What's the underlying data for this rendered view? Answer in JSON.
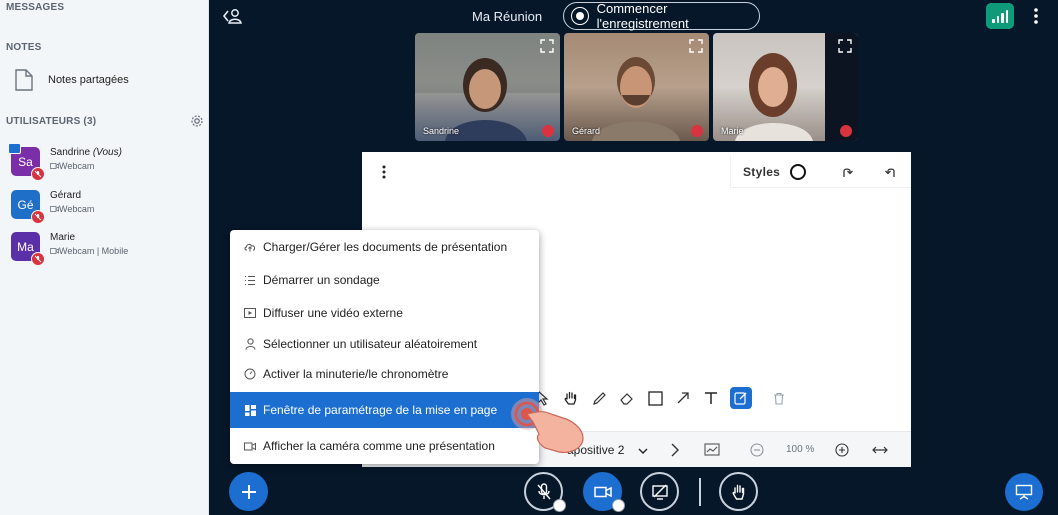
{
  "sidebar": {
    "messages_title": "MESSAGES",
    "notes_title": "NOTES",
    "notes_item": "Notes partagées",
    "users_title": "UTILISATEURS (3)",
    "users": [
      {
        "initials": "Sa",
        "name": "Sandrine",
        "you": "(Vous)",
        "status": "Webcam",
        "color": "#7a2fa8"
      },
      {
        "initials": "Gé",
        "name": "Gérard",
        "you": "",
        "status": "Webcam",
        "color": "#1f6fc9"
      },
      {
        "initials": "Ma",
        "name": "Marie",
        "you": "",
        "status": "Webcam | Mobile",
        "color": "#5a2fa8"
      }
    ]
  },
  "topbar": {
    "meeting_title": "Ma Réunion",
    "record_label": "Commencer l'enregistrement"
  },
  "videos": [
    {
      "name": "Sandrine"
    },
    {
      "name": "Gérard"
    },
    {
      "name": "Marie"
    }
  ],
  "whiteboard": {
    "styles_label": "Styles",
    "slide_label": "apositive 2",
    "zoom_label": "100 %"
  },
  "menu": {
    "items": [
      {
        "label": "Charger/Gérer les documents de présentation",
        "icon": "cloud-upload-icon"
      },
      {
        "label": "Démarrer un sondage",
        "icon": "list-icon"
      },
      {
        "label": "Diffuser une vidéo externe",
        "icon": "video-external-icon"
      },
      {
        "label": "Sélectionner un utilisateur aléatoirement",
        "icon": "user-icon"
      },
      {
        "label": "Activer la minuterie/le chronomètre",
        "icon": "timer-icon"
      },
      {
        "label": "Fenêtre de paramétrage de la mise en page",
        "icon": "layout-icon"
      },
      {
        "label": "Afficher la caméra comme une présentation",
        "icon": "camera-icon"
      }
    ]
  },
  "colors": {
    "accent": "#1c6fd0",
    "background": "#06172a",
    "mute": "#d9333f",
    "connection": "#0f9a7a"
  }
}
